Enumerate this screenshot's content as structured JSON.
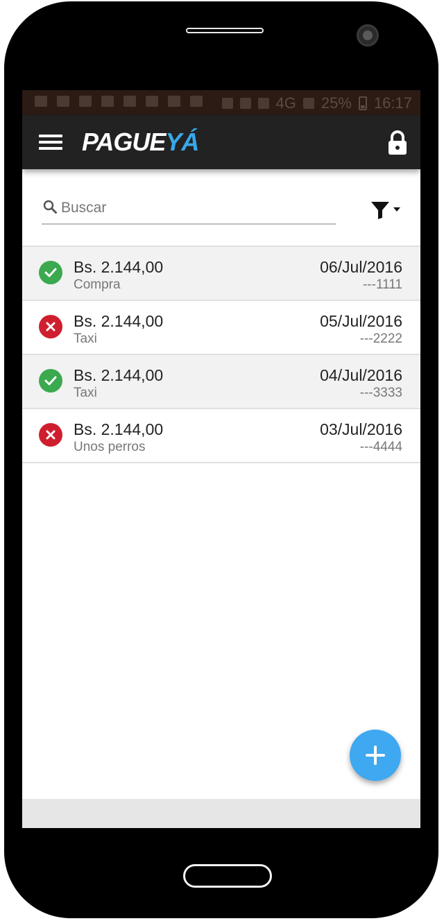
{
  "statusbar": {
    "battery_text": "25%",
    "time": "16:17",
    "network_text": "4G"
  },
  "appbar": {
    "logo_part1": "PAGUE",
    "logo_part2": "YÁ"
  },
  "search": {
    "placeholder": "Buscar"
  },
  "transactions": [
    {
      "status": "approved",
      "amount": "Bs. 2.144,00",
      "description": "Compra",
      "date": "06/Jul/2016",
      "reference": "---1111"
    },
    {
      "status": "rejected",
      "amount": "Bs. 2.144,00",
      "description": "Taxi",
      "date": "05/Jul/2016",
      "reference": "---2222"
    },
    {
      "status": "approved",
      "amount": "Bs. 2.144,00",
      "description": "Taxi",
      "date": "04/Jul/2016",
      "reference": "---3333"
    },
    {
      "status": "rejected",
      "amount": "Bs. 2.144,00",
      "description": "Unos perros",
      "date": "03/Jul/2016",
      "reference": "---4444"
    }
  ],
  "colors": {
    "approved": "#3aa94f",
    "rejected": "#cf1f2e",
    "accent": "#3ea8f1",
    "appbar": "#222222"
  },
  "icons": {
    "menu": "hamburger-icon",
    "lock": "lock-icon",
    "search": "search-icon",
    "filter": "filter-icon",
    "fab": "plus-icon"
  }
}
